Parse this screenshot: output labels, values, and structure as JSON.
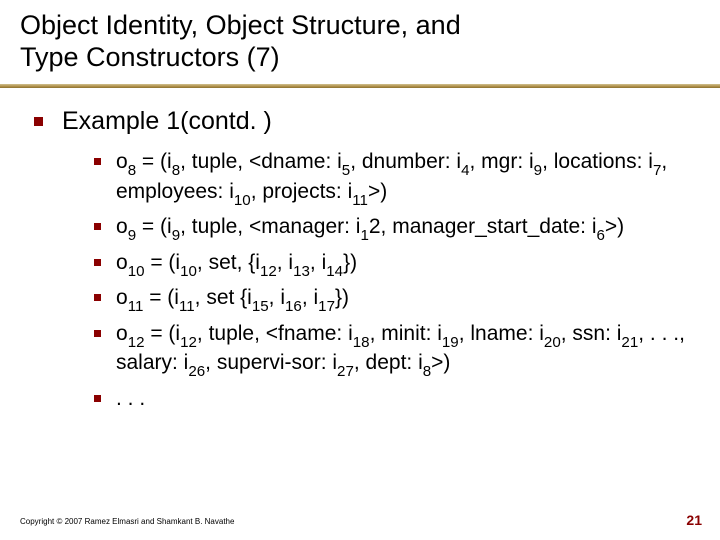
{
  "title_line1": "Object Identity, Object Structure, and",
  "title_line2": "Type Constructors (7)",
  "heading": "Example 1(contd. )",
  "items": [
    {
      "parts": [
        {
          "t": "o"
        },
        {
          "t": "8",
          "s": true
        },
        {
          "t": " = (i"
        },
        {
          "t": "8",
          "s": true
        },
        {
          "t": ", tuple, <dname: i"
        },
        {
          "t": "5",
          "s": true
        },
        {
          "t": ", dnumber: i"
        },
        {
          "t": "4",
          "s": true
        },
        {
          "t": ", mgr: i"
        },
        {
          "t": "9",
          "s": true
        },
        {
          "t": ", locations: i"
        },
        {
          "t": "7",
          "s": true
        },
        {
          "t": ", employees: i"
        },
        {
          "t": "10",
          "s": true
        },
        {
          "t": ", projects: i"
        },
        {
          "t": "11",
          "s": true
        },
        {
          "t": ">)"
        }
      ]
    },
    {
      "parts": [
        {
          "t": "o"
        },
        {
          "t": "9",
          "s": true
        },
        {
          "t": " = (i"
        },
        {
          "t": "9",
          "s": true
        },
        {
          "t": ", tuple, <manager: i"
        },
        {
          "t": "1",
          "s": true
        },
        {
          "t": "2, manager_start_date: i"
        },
        {
          "t": "6",
          "s": true
        },
        {
          "t": ">)"
        }
      ]
    },
    {
      "parts": [
        {
          "t": "o"
        },
        {
          "t": "10",
          "s": true
        },
        {
          "t": " = (i"
        },
        {
          "t": "10",
          "s": true
        },
        {
          "t": ", set, {i"
        },
        {
          "t": "12",
          "s": true
        },
        {
          "t": ", i"
        },
        {
          "t": "13",
          "s": true
        },
        {
          "t": ", i"
        },
        {
          "t": "14",
          "s": true
        },
        {
          "t": "})"
        }
      ]
    },
    {
      "parts": [
        {
          "t": "o"
        },
        {
          "t": "11",
          "s": true
        },
        {
          "t": " = (i"
        },
        {
          "t": "11",
          "s": true
        },
        {
          "t": ", set {i"
        },
        {
          "t": "15",
          "s": true
        },
        {
          "t": ", i"
        },
        {
          "t": "16",
          "s": true
        },
        {
          "t": ", i"
        },
        {
          "t": "17",
          "s": true
        },
        {
          "t": "})"
        }
      ]
    },
    {
      "parts": [
        {
          "t": "o"
        },
        {
          "t": "12",
          "s": true
        },
        {
          "t": " = (i"
        },
        {
          "t": "12",
          "s": true
        },
        {
          "t": ", tuple, <fname: i"
        },
        {
          "t": "18",
          "s": true
        },
        {
          "t": ", minit: i"
        },
        {
          "t": "19",
          "s": true
        },
        {
          "t": ", lname: i"
        },
        {
          "t": "20",
          "s": true
        },
        {
          "t": ", ssn: i"
        },
        {
          "t": "21",
          "s": true
        },
        {
          "t": ", . . ., salary: i"
        },
        {
          "t": "26",
          "s": true
        },
        {
          "t": ", supervi-sor: i"
        },
        {
          "t": "27",
          "s": true
        },
        {
          "t": ", dept: i"
        },
        {
          "t": "8",
          "s": true
        },
        {
          "t": ">)"
        }
      ]
    },
    {
      "parts": [
        {
          "t": ". . ."
        }
      ]
    }
  ],
  "copyright": "Copyright © 2007 Ramez Elmasri and Shamkant B. Navathe",
  "page_number": "21"
}
